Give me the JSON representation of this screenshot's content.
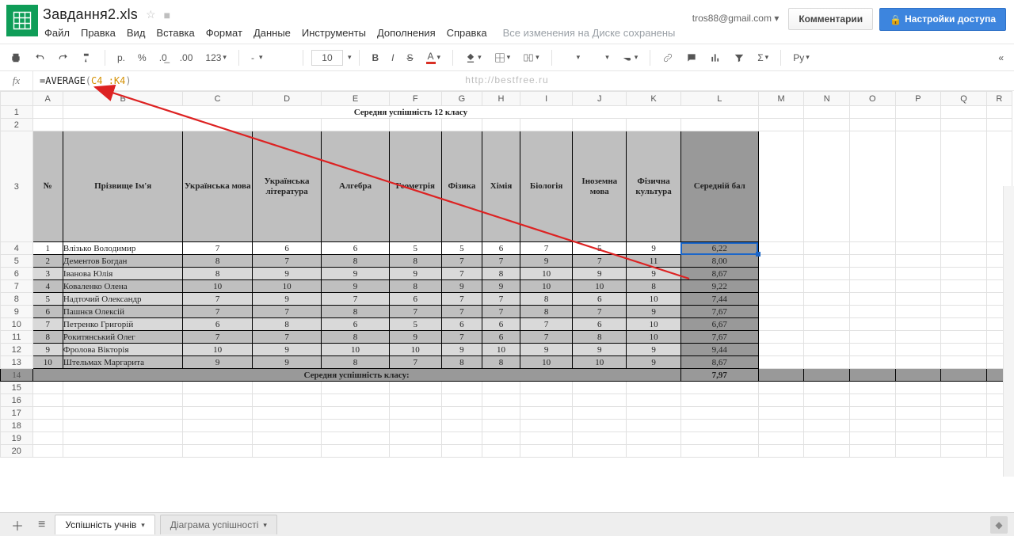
{
  "header": {
    "email": "tros88@gmail.com",
    "doc_title": "Завдання2.xls",
    "comments_btn": "Комментарии",
    "share_btn": "Настройки доступа",
    "save_note": "Все изменения на Диске сохранены",
    "menus": [
      "Файл",
      "Правка",
      "Вид",
      "Вставка",
      "Формат",
      "Данные",
      "Инструменты",
      "Дополнения",
      "Справка"
    ]
  },
  "toolbar": {
    "currency": "р.",
    "percent": "%",
    "dec_dec": ".0",
    "dec_inc": ".00",
    "num_fmt": "123",
    "font": "-",
    "font_size": "10",
    "script_label": "Py"
  },
  "formula": {
    "fn": "=AVERAGE",
    "open": "(",
    "range": "C4 :K4",
    "close": ")"
  },
  "columns": [
    "A",
    "B",
    "C",
    "D",
    "E",
    "F",
    "G",
    "H",
    "I",
    "J",
    "K",
    "L",
    "M",
    "N",
    "O",
    "P",
    "Q",
    "R"
  ],
  "row_numbers": [
    "1",
    "2",
    "3",
    "4",
    "5",
    "6",
    "7",
    "8",
    "9",
    "10",
    "11",
    "12",
    "13",
    "14",
    "15",
    "16",
    "17",
    "18",
    "19",
    "20"
  ],
  "sheet": {
    "title": "Середня успішність 12 класу",
    "headers": [
      "№",
      "Прізвище Ім'я",
      "Українська мова",
      "Українська література",
      "Алгебра",
      "Геометрія",
      "Фізика",
      "Хімія",
      "Біологія",
      "Іноземна мова",
      "Фізична культура",
      "Середній бал"
    ],
    "footer_label": "Середня успішність класу:",
    "footer_value": "7,97",
    "rows": [
      {
        "n": "1",
        "name": "Влізько Володимир",
        "g": [
          "7",
          "6",
          "6",
          "5",
          "5",
          "6",
          "7",
          "5",
          "9"
        ],
        "avg": "6,22"
      },
      {
        "n": "2",
        "name": "Дементов Богдан",
        "g": [
          "8",
          "7",
          "8",
          "8",
          "7",
          "7",
          "9",
          "7",
          "11"
        ],
        "avg": "8,00"
      },
      {
        "n": "3",
        "name": "Іванова Юлія",
        "g": [
          "8",
          "9",
          "9",
          "9",
          "7",
          "8",
          "10",
          "9",
          "9"
        ],
        "avg": "8,67"
      },
      {
        "n": "4",
        "name": "Коваленко Олена",
        "g": [
          "10",
          "10",
          "9",
          "8",
          "9",
          "9",
          "10",
          "10",
          "8"
        ],
        "avg": "9,22"
      },
      {
        "n": "5",
        "name": "Надточий Олександр",
        "g": [
          "7",
          "9",
          "7",
          "6",
          "7",
          "7",
          "8",
          "6",
          "10"
        ],
        "avg": "7,44"
      },
      {
        "n": "6",
        "name": "Пашнєв Олексій",
        "g": [
          "7",
          "7",
          "8",
          "7",
          "7",
          "7",
          "8",
          "7",
          "9"
        ],
        "avg": "7,67"
      },
      {
        "n": "7",
        "name": "Петренко Григорій",
        "g": [
          "6",
          "8",
          "6",
          "5",
          "6",
          "6",
          "7",
          "6",
          "10"
        ],
        "avg": "6,67"
      },
      {
        "n": "8",
        "name": "Рокитянський Олег",
        "g": [
          "7",
          "7",
          "8",
          "9",
          "7",
          "6",
          "7",
          "8",
          "10"
        ],
        "avg": "7,67"
      },
      {
        "n": "9",
        "name": "Фролова Вікторія",
        "g": [
          "10",
          "9",
          "10",
          "10",
          "9",
          "10",
          "9",
          "9",
          "9"
        ],
        "avg": "9,44"
      },
      {
        "n": "10",
        "name": "Штельмах Маргарита",
        "g": [
          "9",
          "9",
          "8",
          "7",
          "8",
          "8",
          "10",
          "10",
          "9"
        ],
        "avg": "8,67"
      }
    ]
  },
  "tabs": {
    "active": "Успішність  учнів",
    "inactive": "Діаграма успішності"
  },
  "watermark": "http://bestfree.ru",
  "chart_data": {
    "type": "table",
    "title": "Середня успішність 12 класу",
    "columns": [
      "№",
      "Прізвище Ім'я",
      "Українська мова",
      "Українська література",
      "Алгебра",
      "Геометрія",
      "Фізика",
      "Хімія",
      "Біологія",
      "Іноземна мова",
      "Фізична культура",
      "Середній бал"
    ],
    "rows": [
      [
        1,
        "Влізько Володимир",
        7,
        6,
        6,
        5,
        5,
        6,
        7,
        5,
        9,
        6.22
      ],
      [
        2,
        "Дементов Богдан",
        8,
        7,
        8,
        8,
        7,
        7,
        9,
        7,
        11,
        8.0
      ],
      [
        3,
        "Іванова Юлія",
        8,
        9,
        9,
        9,
        7,
        8,
        10,
        9,
        9,
        8.67
      ],
      [
        4,
        "Коваленко Олена",
        10,
        10,
        9,
        8,
        9,
        9,
        10,
        10,
        8,
        9.22
      ],
      [
        5,
        "Надточий Олександр",
        7,
        9,
        7,
        6,
        7,
        7,
        8,
        6,
        10,
        7.44
      ],
      [
        6,
        "Пашнєв Олексій",
        7,
        7,
        8,
        7,
        7,
        7,
        8,
        7,
        9,
        7.67
      ],
      [
        7,
        "Петренко Григорій",
        6,
        8,
        6,
        5,
        6,
        6,
        7,
        6,
        10,
        6.67
      ],
      [
        8,
        "Рокитянський Олег",
        7,
        7,
        8,
        9,
        7,
        6,
        7,
        8,
        10,
        7.67
      ],
      [
        9,
        "Фролова Вікторія",
        10,
        9,
        10,
        10,
        9,
        10,
        9,
        9,
        9,
        9.44
      ],
      [
        10,
        "Штельмах Маргарита",
        9,
        9,
        8,
        7,
        8,
        8,
        10,
        10,
        9,
        8.67
      ]
    ],
    "footer": [
      "Середня успішність класу:",
      7.97
    ]
  }
}
